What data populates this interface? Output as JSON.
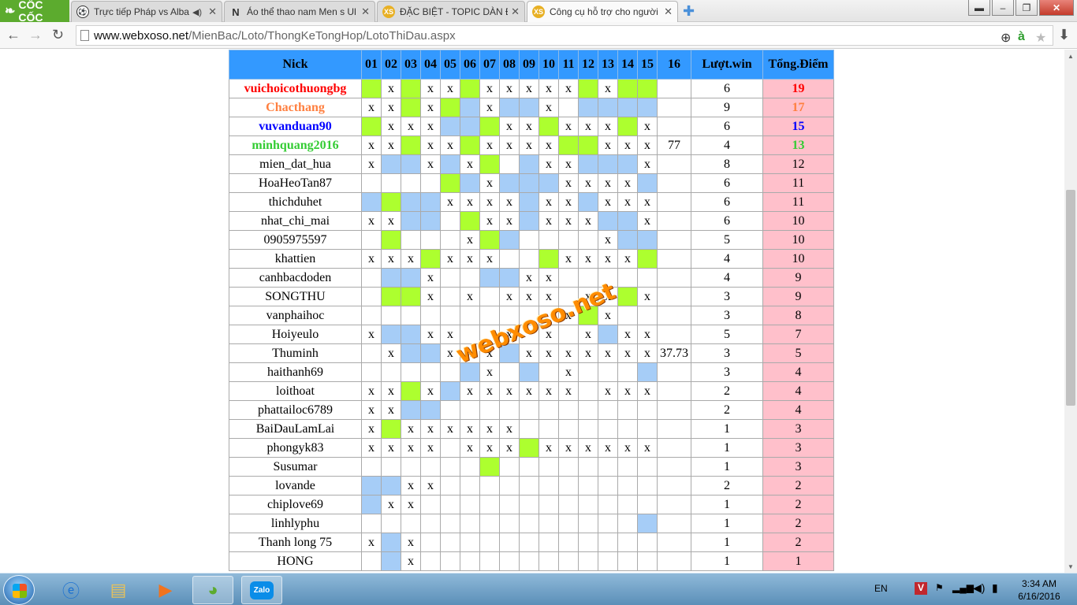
{
  "browser": {
    "brand": "CỐC CỐC",
    "tabs": [
      {
        "title": "Trực tiếp Pháp vs Alban",
        "favicon": "soccer-ball-icon"
      },
      {
        "title": "Áo thể thao nam Men s Ul",
        "favicon": "n-icon"
      },
      {
        "title": "ĐẶC BIỆT - TOPIC DÀN ĐẶ",
        "favicon": "xs-icon"
      },
      {
        "title": "Công cụ hỗ trợ cho người",
        "favicon": "xs-icon"
      }
    ],
    "url_host": "www.webxoso.net",
    "url_path": "/MienBac/Loto/ThongKeTongHop/LotoThiDau.aspx"
  },
  "table": {
    "headers": [
      "Nick",
      "01",
      "02",
      "03",
      "04",
      "05",
      "06",
      "07",
      "08",
      "09",
      "10",
      "11",
      "12",
      "13",
      "14",
      "15",
      "16",
      "Lượt.win",
      "Tổng.Điểm"
    ],
    "rows": [
      {
        "nick": "vuichoicothuongbg",
        "cells": [
          "g",
          "x",
          "g",
          "x",
          "x",
          "g",
          "x",
          "x",
          "x",
          "x",
          "x",
          "g",
          "x",
          "g",
          "g",
          ""
        ],
        "c16": "",
        "win": "6",
        "pts": "19",
        "color": "#ff0000"
      },
      {
        "nick": "Chacthang",
        "cells": [
          "x",
          "x",
          "g",
          "x",
          "g",
          "b",
          "x",
          "b",
          "b",
          "x",
          "",
          "b",
          "b",
          "b",
          "b",
          ""
        ],
        "c16": "",
        "win": "9",
        "pts": "17",
        "color": "#ff7f3f"
      },
      {
        "nick": "vuvanduan90",
        "cells": [
          "g",
          "x",
          "x",
          "x",
          "b",
          "b",
          "g",
          "x",
          "x",
          "g",
          "x",
          "x",
          "x",
          "g",
          "x",
          ""
        ],
        "c16": "",
        "win": "6",
        "pts": "15",
        "color": "#0000ff"
      },
      {
        "nick": "minhquang2016",
        "cells": [
          "x",
          "x",
          "g",
          "x",
          "x",
          "g",
          "x",
          "x",
          "x",
          "x",
          "g",
          "g",
          "x",
          "x",
          "x",
          "t"
        ],
        "c16": "77",
        "win": "4",
        "pts": "13",
        "color": "#33cc33"
      },
      {
        "nick": "mien_dat_hua",
        "cells": [
          "x",
          "b",
          "b",
          "x",
          "b",
          "x",
          "g",
          "",
          "b",
          "x",
          "x",
          "b",
          "b",
          "b",
          "x",
          ""
        ],
        "c16": "",
        "win": "8",
        "pts": "12",
        "color": ""
      },
      {
        "nick": "HoaHeoTan87",
        "cells": [
          "",
          "",
          "",
          "",
          "g",
          "b",
          "x",
          "b",
          "b",
          "b",
          "x",
          "x",
          "x",
          "x",
          "b",
          ""
        ],
        "c16": "",
        "win": "6",
        "pts": "11",
        "color": ""
      },
      {
        "nick": "thichduhet",
        "cells": [
          "b",
          "g",
          "b",
          "b",
          "x",
          "x",
          "x",
          "x",
          "b",
          "x",
          "x",
          "b",
          "x",
          "x",
          "x",
          ""
        ],
        "c16": "",
        "win": "6",
        "pts": "11",
        "color": ""
      },
      {
        "nick": "nhat_chi_mai",
        "cells": [
          "x",
          "x",
          "b",
          "b",
          "",
          "g",
          "x",
          "x",
          "b",
          "x",
          "x",
          "x",
          "b",
          "b",
          "x",
          ""
        ],
        "c16": "",
        "win": "6",
        "pts": "10",
        "color": ""
      },
      {
        "nick": "0905975597",
        "cells": [
          "",
          "g",
          "",
          "",
          "",
          "x",
          "g",
          "b",
          "",
          "",
          "",
          "",
          "x",
          "b",
          "b",
          ""
        ],
        "c16": "",
        "win": "5",
        "pts": "10",
        "color": ""
      },
      {
        "nick": "khattien",
        "cells": [
          "x",
          "x",
          "x",
          "g",
          "x",
          "x",
          "x",
          "",
          "",
          "g",
          "x",
          "x",
          "x",
          "x",
          "g",
          ""
        ],
        "c16": "",
        "win": "4",
        "pts": "10",
        "color": ""
      },
      {
        "nick": "canhbacdoden",
        "cells": [
          "",
          "b",
          "b",
          "x",
          "",
          "",
          "b",
          "b",
          "x",
          "x",
          "",
          "",
          "",
          "",
          "",
          ""
        ],
        "c16": "",
        "win": "4",
        "pts": "9",
        "color": ""
      },
      {
        "nick": "SONGTHU",
        "cells": [
          "",
          "g",
          "g",
          "x",
          "",
          "x",
          "",
          "x",
          "x",
          "x",
          "",
          "x",
          "x",
          "g",
          "x",
          ""
        ],
        "c16": "",
        "win": "3",
        "pts": "9",
        "color": ""
      },
      {
        "nick": "vanphaihoc",
        "cells": [
          "",
          "",
          "",
          "",
          "",
          "",
          "",
          "",
          "",
          "",
          "x",
          "g",
          "x",
          "",
          "",
          ""
        ],
        "c16": "",
        "win": "3",
        "pts": "8",
        "color": ""
      },
      {
        "nick": "Hoiyeulo",
        "cells": [
          "x",
          "b",
          "b",
          "x",
          "x",
          "",
          "",
          "x",
          "",
          "x",
          "",
          "x",
          "b",
          "x",
          "x",
          ""
        ],
        "c16": "",
        "win": "5",
        "pts": "7",
        "color": ""
      },
      {
        "nick": "Thuminh",
        "cells": [
          "",
          "x",
          "b",
          "b",
          "x",
          "x",
          "x",
          "b",
          "x",
          "x",
          "x",
          "x",
          "x",
          "x",
          "x",
          "t"
        ],
        "c16": "37.73",
        "win": "3",
        "pts": "5",
        "color": ""
      },
      {
        "nick": "haithanh69",
        "cells": [
          "",
          "",
          "",
          "",
          "",
          "b",
          "x",
          "",
          "b",
          "",
          "x",
          "",
          "",
          "",
          "b",
          ""
        ],
        "c16": "",
        "win": "3",
        "pts": "4",
        "color": ""
      },
      {
        "nick": "loithoat",
        "cells": [
          "x",
          "x",
          "g",
          "x",
          "b",
          "x",
          "x",
          "x",
          "x",
          "x",
          "x",
          "",
          "x",
          "x",
          "x",
          ""
        ],
        "c16": "",
        "win": "2",
        "pts": "4",
        "color": ""
      },
      {
        "nick": "phattailoc6789",
        "cells": [
          "x",
          "x",
          "b",
          "b",
          "",
          "",
          "",
          "",
          "",
          "",
          "",
          "",
          "",
          "",
          "",
          ""
        ],
        "c16": "",
        "win": "2",
        "pts": "4",
        "color": ""
      },
      {
        "nick": "BaiDauLamLai",
        "cells": [
          "x",
          "g",
          "x",
          "x",
          "x",
          "x",
          "x",
          "x",
          "",
          "",
          "",
          "",
          "",
          "",
          "",
          ""
        ],
        "c16": "",
        "win": "1",
        "pts": "3",
        "color": ""
      },
      {
        "nick": "phongyk83",
        "cells": [
          "x",
          "x",
          "x",
          "x",
          "",
          "x",
          "x",
          "x",
          "g",
          "x",
          "x",
          "x",
          "x",
          "x",
          "x",
          ""
        ],
        "c16": "",
        "win": "1",
        "pts": "3",
        "color": ""
      },
      {
        "nick": "Susumar",
        "cells": [
          "",
          "",
          "",
          "",
          "",
          "",
          "g",
          "",
          "",
          "",
          "",
          "",
          "",
          "",
          "",
          ""
        ],
        "c16": "",
        "win": "1",
        "pts": "3",
        "color": ""
      },
      {
        "nick": "lovande",
        "cells": [
          "b",
          "b",
          "x",
          "x",
          "",
          "",
          "",
          "",
          "",
          "",
          "",
          "",
          "",
          "",
          "",
          ""
        ],
        "c16": "",
        "win": "2",
        "pts": "2",
        "color": ""
      },
      {
        "nick": "chiplove69",
        "cells": [
          "b",
          "x",
          "x",
          "",
          "",
          "",
          "",
          "",
          "",
          "",
          "",
          "",
          "",
          "",
          "",
          ""
        ],
        "c16": "",
        "win": "1",
        "pts": "2",
        "color": ""
      },
      {
        "nick": "linhlyphu",
        "cells": [
          "",
          "",
          "",
          "",
          "",
          "",
          "",
          "",
          "",
          "",
          "",
          "",
          "",
          "",
          "b",
          ""
        ],
        "c16": "",
        "win": "1",
        "pts": "2",
        "color": ""
      },
      {
        "nick": "Thanh long 75",
        "cells": [
          "x",
          "b",
          "x",
          "",
          "",
          "",
          "",
          "",
          "",
          "",
          "",
          "",
          "",
          "",
          "",
          ""
        ],
        "c16": "",
        "win": "1",
        "pts": "2",
        "color": ""
      },
      {
        "nick": "HONG",
        "cells": [
          "",
          "b",
          "x",
          "",
          "",
          "",
          "",
          "",
          "",
          "",
          "",
          "",
          "",
          "",
          "",
          ""
        ],
        "c16": "",
        "win": "1",
        "pts": "1",
        "color": ""
      }
    ]
  },
  "colors": {
    "header": "#3399ff",
    "green_cell": "#adff2f",
    "blue_cell": "#a6cdf7",
    "points_bg": "#ffc0cb"
  },
  "watermark": "webxoso.net",
  "taskbar": {
    "apps": [
      "internet-explorer-icon",
      "file-explorer-icon",
      "media-player-icon",
      "coccoc-browser-icon",
      "zalo-icon"
    ],
    "zalo_label": "Zalo",
    "lang": "EN",
    "time": "3:34 AM",
    "date": "6/16/2016"
  }
}
